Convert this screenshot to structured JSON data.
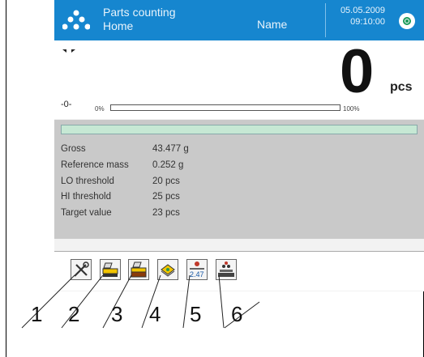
{
  "header": {
    "title": "Parts counting",
    "subtitle": "Home",
    "user": "Name",
    "date": "05.05.2009",
    "time": "09:10:00"
  },
  "weighing": {
    "display_value": "0",
    "unit": "pcs",
    "zero_indicator": "-0-",
    "progress_min_label": "0%",
    "progress_max_label": "100%",
    "progress_fraction": 0.0
  },
  "info_rows": [
    {
      "label": "Gross",
      "value": "43.477 g"
    },
    {
      "label": "Reference mass",
      "value": "0.252 g"
    },
    {
      "label": "LO threshold",
      "value": "20 pcs"
    },
    {
      "label": "HI threshold",
      "value": "25 pcs"
    },
    {
      "label": "Target value",
      "value": "23 pcs"
    }
  ],
  "toolbar": {
    "buttons": [
      {
        "icon": "tools-icon",
        "number": "1"
      },
      {
        "icon": "tare-icon",
        "number": "2"
      },
      {
        "icon": "reference-mass-icon",
        "number": "3"
      },
      {
        "icon": "database-icon",
        "number": "4"
      },
      {
        "icon": "threshold-value-icon",
        "number": "5",
        "label": "2.47"
      },
      {
        "icon": "set-samples-icon",
        "number": "6"
      }
    ]
  },
  "colors": {
    "header_bg": "#1686cf",
    "info_bg": "#c9c9c9",
    "green_bar": "#c6e8d4"
  }
}
